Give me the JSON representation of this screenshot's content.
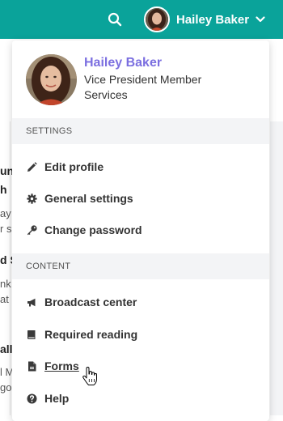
{
  "header": {
    "user_name": "Hailey Baker",
    "bar_color": "#0aa39a"
  },
  "background_text": [
    "un",
    "h",
    "ay",
    "r s",
    "d S",
    "nk",
    "at",
    "all",
    "l M",
    "goo"
  ],
  "dropdown": {
    "profile": {
      "name": "Hailey Baker",
      "title": "Vice President Member Services",
      "name_color": "#7b6fe0"
    },
    "sections": [
      {
        "header": "SETTINGS",
        "items": [
          {
            "label": "Edit profile",
            "icon": "pencil-icon"
          },
          {
            "label": "General settings",
            "icon": "gear-icon"
          },
          {
            "label": "Change password",
            "icon": "key-icon"
          }
        ]
      },
      {
        "header": "CONTENT",
        "items": [
          {
            "label": "Broadcast center",
            "icon": "megaphone-icon"
          },
          {
            "label": "Required reading",
            "icon": "book-icon"
          },
          {
            "label": "Forms",
            "icon": "document-icon"
          },
          {
            "label": "Help",
            "icon": "question-circle-icon"
          }
        ]
      }
    ]
  }
}
